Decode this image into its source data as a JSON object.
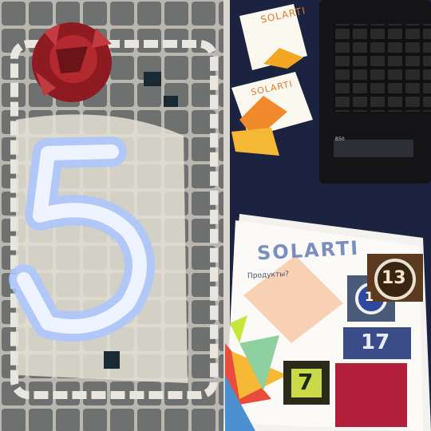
{
  "photo": {
    "mosaic_number": "5",
    "brand_card_top": "SOLARTI",
    "brand_card_middle": "SOLARTI",
    "brand_flyer": "SOLARTI",
    "flyer_heading": "Продукты?",
    "laptop_label": "B50",
    "flyer_tiles": [
      "1",
      "13",
      "17",
      "7"
    ]
  }
}
